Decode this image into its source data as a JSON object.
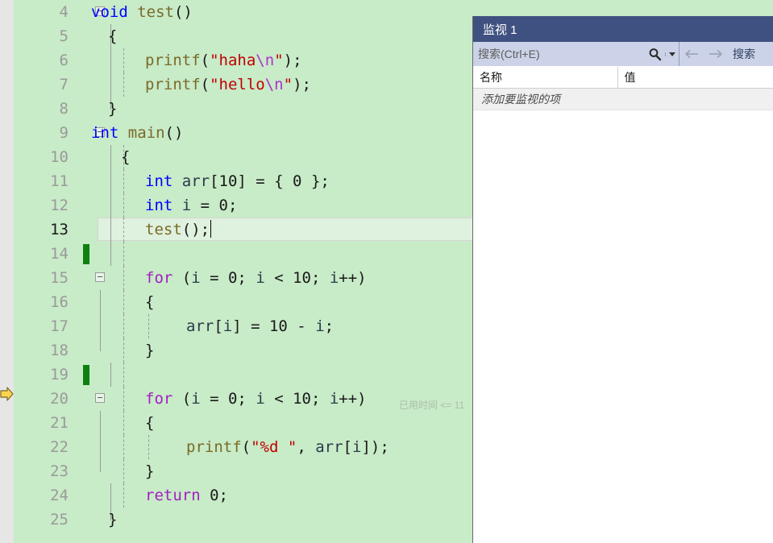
{
  "editor": {
    "background_color": "#c8ebc8",
    "margin_color": "#e6e6e6",
    "current_line_number": "13",
    "exec_pointer_line": "20",
    "elapsed_annotation": "已用时间 <= 11",
    "lines": [
      {
        "n": "4",
        "text": "void test()"
      },
      {
        "n": "5",
        "text": "{"
      },
      {
        "n": "6",
        "text": "    printf(\"haha\\n\");"
      },
      {
        "n": "7",
        "text": "    printf(\"hello\\n\");"
      },
      {
        "n": "8",
        "text": "}"
      },
      {
        "n": "9",
        "text": "int main()"
      },
      {
        "n": "10",
        "text": "{"
      },
      {
        "n": "11",
        "text": "    int arr[10] = { 0 };"
      },
      {
        "n": "12",
        "text": "    int i = 0;"
      },
      {
        "n": "13",
        "text": "    test();"
      },
      {
        "n": "14",
        "text": ""
      },
      {
        "n": "15",
        "text": "    for (i = 0; i < 10; i++)"
      },
      {
        "n": "16",
        "text": "    {"
      },
      {
        "n": "17",
        "text": "        arr[i] = 10 - i;"
      },
      {
        "n": "18",
        "text": "    }"
      },
      {
        "n": "19",
        "text": ""
      },
      {
        "n": "20",
        "text": "    for (i = 0; i < 10; i++)"
      },
      {
        "n": "21",
        "text": "    {"
      },
      {
        "n": "22",
        "text": "        printf(\"%d \", arr[i]);"
      },
      {
        "n": "23",
        "text": "    }"
      },
      {
        "n": "24",
        "text": "    return 0;"
      },
      {
        "n": "25",
        "text": "}"
      }
    ],
    "tokens": {
      "l4": [
        [
          "void",
          "kw"
        ],
        [
          " ",
          "punc"
        ],
        [
          "test",
          "fn"
        ],
        [
          "()",
          "punc"
        ]
      ],
      "l5": [
        [
          "{",
          "punc"
        ]
      ],
      "l6": [
        [
          "printf",
          "fn"
        ],
        [
          "(",
          "punc"
        ],
        [
          "\"haha",
          "str"
        ],
        [
          "\\n",
          "esc"
        ],
        [
          "\"",
          "str"
        ],
        [
          ")",
          "punc"
        ],
        [
          ";",
          "punc"
        ]
      ],
      "l7": [
        [
          "printf",
          "fn"
        ],
        [
          "(",
          "punc"
        ],
        [
          "\"hello",
          "str"
        ],
        [
          "\\n",
          "esc"
        ],
        [
          "\"",
          "str"
        ],
        [
          ")",
          "punc"
        ],
        [
          ";",
          "punc"
        ]
      ],
      "l8": [
        [
          "}",
          "punc"
        ]
      ],
      "l9": [
        [
          "int",
          "kw"
        ],
        [
          " ",
          "punc"
        ],
        [
          "main",
          "fn"
        ],
        [
          "()",
          "punc"
        ]
      ],
      "l10": [
        [
          "{",
          "punc"
        ]
      ],
      "l11": [
        [
          "int",
          "kw"
        ],
        [
          " ",
          "punc"
        ],
        [
          "arr",
          "id"
        ],
        [
          "[10] = { 0 };",
          "punc"
        ]
      ],
      "l12": [
        [
          "int",
          "kw"
        ],
        [
          " ",
          "punc"
        ],
        [
          "i",
          "id"
        ],
        [
          " = 0;",
          "punc"
        ]
      ],
      "l13": [
        [
          "test",
          "fn"
        ],
        [
          "();",
          "punc"
        ]
      ],
      "l15": [
        [
          "for",
          "ctrl"
        ],
        [
          " (",
          "punc"
        ],
        [
          "i",
          "id"
        ],
        [
          " = 0; ",
          "punc"
        ],
        [
          "i",
          "id"
        ],
        [
          " < 10; ",
          "punc"
        ],
        [
          "i",
          "id"
        ],
        [
          "++)",
          "punc"
        ]
      ],
      "l17": [
        [
          "arr",
          "id"
        ],
        [
          "[",
          "punc"
        ],
        [
          "i",
          "id"
        ],
        [
          "] = 10 - ",
          "punc"
        ],
        [
          "i",
          "id"
        ],
        [
          ";",
          "punc"
        ]
      ],
      "l20": [
        [
          "for",
          "ctrl"
        ],
        [
          " (",
          "punc"
        ],
        [
          "i",
          "id"
        ],
        [
          " = 0; ",
          "punc"
        ],
        [
          "i",
          "id"
        ],
        [
          " < 10; ",
          "punc"
        ],
        [
          "i",
          "id"
        ],
        [
          "++)",
          "punc"
        ]
      ],
      "l22": [
        [
          "printf",
          "fn"
        ],
        [
          "(",
          "punc"
        ],
        [
          "\"",
          "str"
        ],
        [
          "%d",
          "str"
        ],
        [
          " \"",
          "str"
        ],
        [
          ", ",
          "punc"
        ],
        [
          "arr",
          "id"
        ],
        [
          "[",
          "punc"
        ],
        [
          "i",
          "id"
        ],
        [
          "]);",
          "punc"
        ]
      ],
      "l24": [
        [
          "return",
          "ctrl"
        ],
        [
          " 0;",
          "punc"
        ]
      ],
      "l25": [
        [
          "}",
          "punc"
        ]
      ]
    }
  },
  "watch": {
    "title": "监视 1",
    "search_placeholder": "搜索(Ctrl+E)",
    "search_value": "",
    "search_icon": "magnifier-icon",
    "dropdown_icon": "chevron-down-icon",
    "prev_icon": "arrow-left-icon",
    "next_icon": "arrow-right-icon",
    "depth_label": "搜索",
    "columns": [
      "名称",
      "值"
    ],
    "empty_row_text": "添加要监视的项",
    "title_bar_color": "#3f5180",
    "toolbar_color": "#ccd3e8"
  }
}
